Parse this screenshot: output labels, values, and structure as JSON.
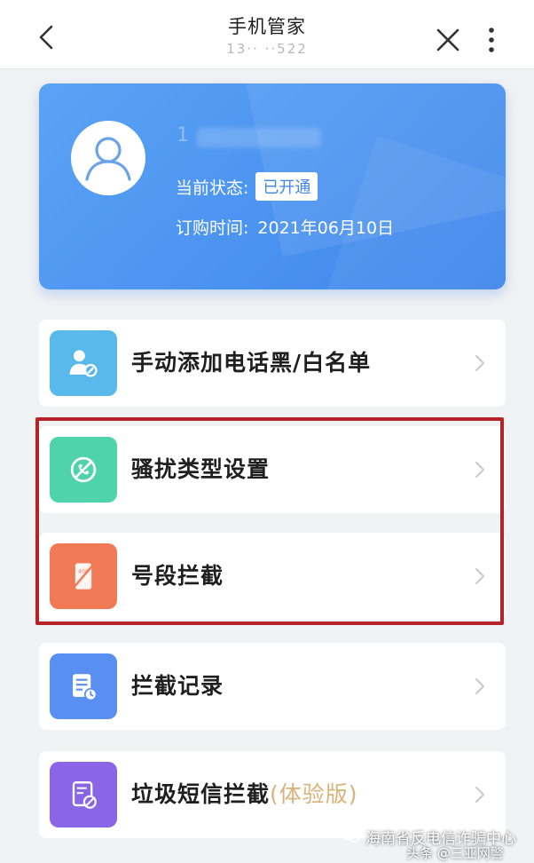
{
  "header": {
    "title": "手机管家",
    "subtitle": "13·· ··522"
  },
  "card": {
    "phone": "1",
    "status_label": "当前状态:",
    "status_value": "已开通",
    "order_label": "订购时间:",
    "order_value": "2021年06月10日"
  },
  "menu": {
    "items": [
      {
        "label": "手动添加电话黑/白名单",
        "icon": "user-block-icon",
        "color": "#5ab9eb"
      },
      {
        "label": "骚扰类型设置",
        "icon": "harass-type-icon",
        "color": "#4fd3a8"
      },
      {
        "label": "号段拦截",
        "icon": "number-range-icon",
        "color": "#f07a56"
      },
      {
        "label": "拦截记录",
        "icon": "intercept-record-icon",
        "color": "#5a8ff2"
      },
      {
        "label": "垃圾短信拦截",
        "note": "(体验版)",
        "icon": "spam-sms-icon",
        "color": "#8a66e6"
      }
    ]
  },
  "watermark": {
    "text": "海南省反电信诈骗中心",
    "source": "头条 @三亚网警"
  },
  "colors": {
    "card_blue": "#4b93f0",
    "highlight_red": "#b5242b",
    "note_gold": "#d9b277"
  }
}
